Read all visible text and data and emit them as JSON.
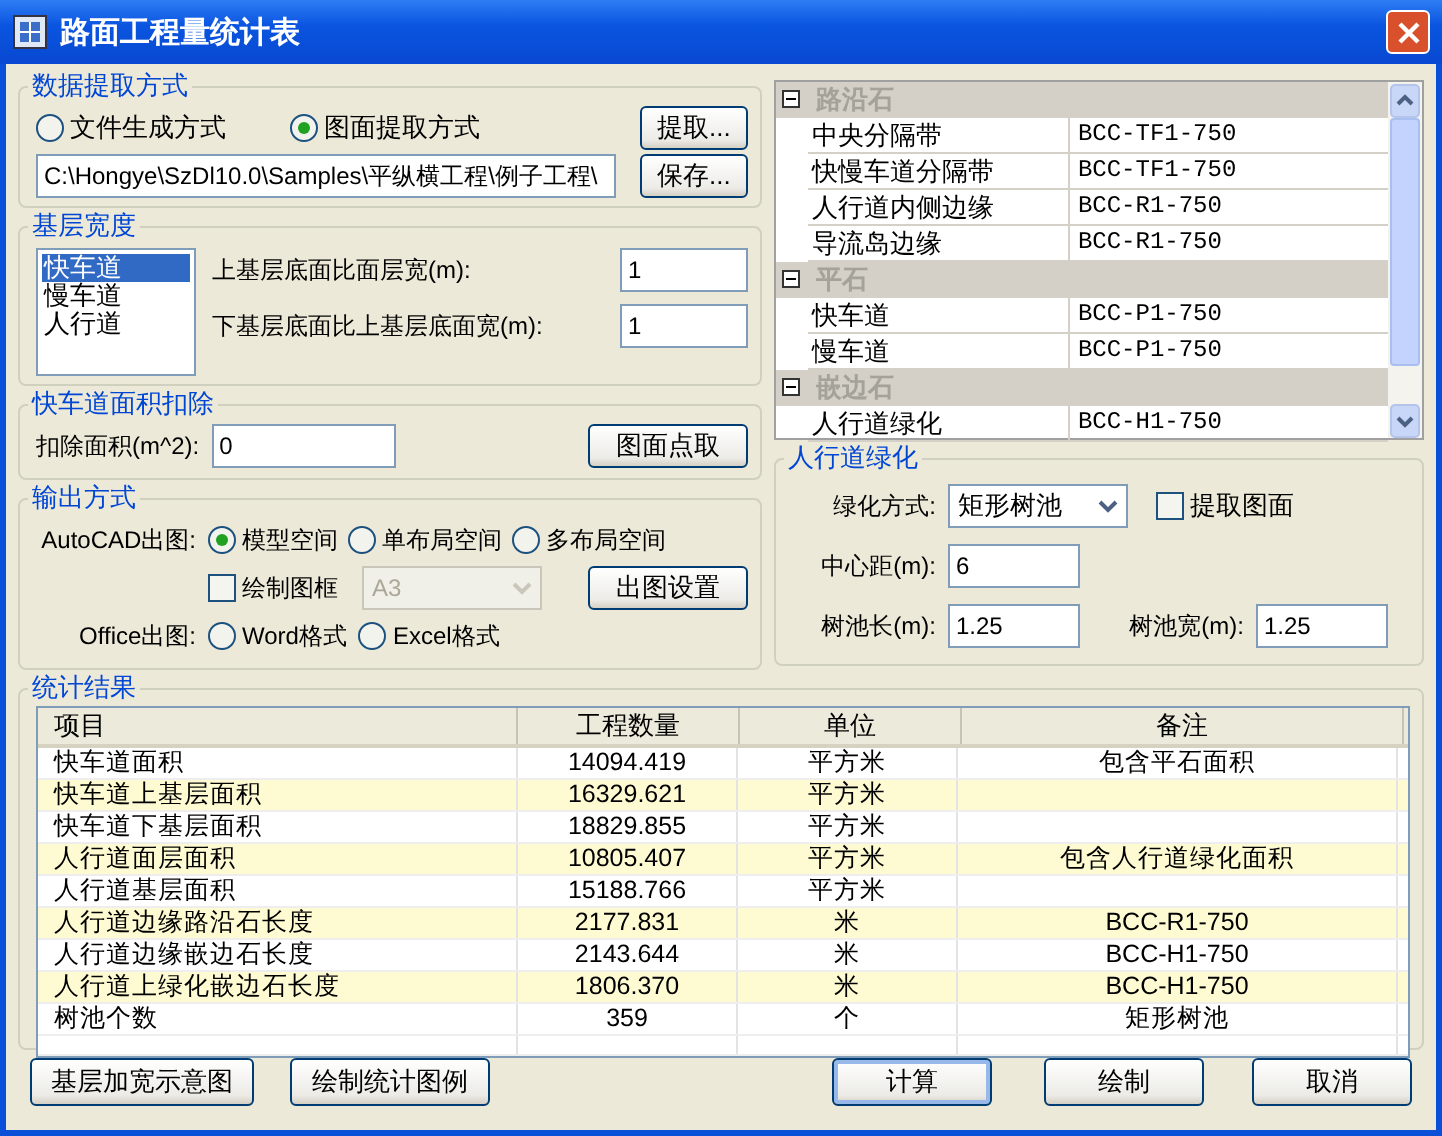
{
  "window": {
    "title": "路面工程量统计表"
  },
  "extraction": {
    "title": "数据提取方式",
    "options": [
      {
        "label": "文件生成方式",
        "selected": false
      },
      {
        "label": "图面提取方式",
        "selected": true
      }
    ],
    "path": "C:\\Hongye\\SzDl10.0\\Samples\\平纵横工程\\例子工程\\",
    "buttons": [
      "提取...",
      "保存..."
    ]
  },
  "base_width": {
    "title": "基层宽度",
    "list": [
      {
        "label": "快车道",
        "selected": true
      },
      {
        "label": "慢车道",
        "selected": false
      },
      {
        "label": "人行道",
        "selected": false
      }
    ],
    "fields": [
      {
        "label": "上基层底面比面层宽(m):",
        "value": "1"
      },
      {
        "label": "下基层底面比上基层底面宽(m):",
        "value": "1"
      }
    ]
  },
  "deduction": {
    "title": "快车道面积扣除",
    "label": "扣除面积(m^2):",
    "value": "0",
    "button": "图面点取"
  },
  "output": {
    "title": "输出方式",
    "autocad_label": "AutoCAD出图:",
    "autocad_options": [
      {
        "label": "模型空间",
        "selected": true
      },
      {
        "label": "单布局空间",
        "selected": false
      },
      {
        "label": "多布局空间",
        "selected": false
      }
    ],
    "frame_checkbox": {
      "label": "绘制图框",
      "checked": false
    },
    "frame_size": {
      "value": "A3",
      "disabled": true
    },
    "settings_button": "出图设置",
    "office_label": "Office出图:",
    "office_options": [
      {
        "label": "Word格式",
        "selected": false
      },
      {
        "label": "Excel格式",
        "selected": false
      }
    ]
  },
  "property_grid": {
    "groups": [
      {
        "name": "路沿石",
        "expanded": true,
        "rows": [
          {
            "name": "中央分隔带",
            "value": "BCC-TF1-750"
          },
          {
            "name": "快慢车道分隔带",
            "value": "BCC-TF1-750"
          },
          {
            "name": "人行道内侧边缘",
            "value": "BCC-R1-750"
          },
          {
            "name": "导流岛边缘",
            "value": "BCC-R1-750"
          }
        ]
      },
      {
        "name": "平石",
        "expanded": true,
        "rows": [
          {
            "name": "快车道",
            "value": "BCC-P1-750"
          },
          {
            "name": "慢车道",
            "value": "BCC-P1-750"
          }
        ]
      },
      {
        "name": "嵌边石",
        "expanded": true,
        "rows": [
          {
            "name": "人行道绿化",
            "value": "BCC-H1-750"
          }
        ]
      }
    ]
  },
  "greening": {
    "title": "人行道绿化",
    "method_label": "绿化方式:",
    "method_value": "矩形树池",
    "extract_checkbox": {
      "label": "提取图面",
      "checked": false
    },
    "center_label": "中心距(m):",
    "center_value": "6",
    "length_label": "树池长(m):",
    "length_value": "1.25",
    "width_label": "树池宽(m):",
    "width_value": "1.25"
  },
  "results": {
    "title": "统计结果",
    "columns": [
      "项目",
      "工程数量",
      "单位",
      "备注"
    ],
    "rows": [
      {
        "cells": [
          "快车道面积",
          "14094.419",
          "平方米",
          "包含平石面积"
        ]
      },
      {
        "cells": [
          "快车道上基层面积",
          "16329.621",
          "平方米",
          ""
        ]
      },
      {
        "cells": [
          "快车道下基层面积",
          "18829.855",
          "平方米",
          ""
        ]
      },
      {
        "cells": [
          "人行道面层面积",
          "10805.407",
          "平方米",
          "包含人行道绿化面积"
        ]
      },
      {
        "cells": [
          "人行道基层面积",
          "15188.766",
          "平方米",
          ""
        ]
      },
      {
        "cells": [
          "人行道边缘路沿石长度",
          "2177.831",
          "米",
          "BCC-R1-750"
        ]
      },
      {
        "cells": [
          "人行道边缘嵌边石长度",
          "2143.644",
          "米",
          "BCC-H1-750"
        ]
      },
      {
        "cells": [
          "人行道上绿化嵌边石长度",
          "1806.370",
          "米",
          "BCC-H1-750"
        ]
      },
      {
        "cells": [
          "树池个数",
          "359",
          "个",
          "矩形树池"
        ]
      }
    ]
  },
  "buttons": [
    {
      "label": "基层加宽示意图",
      "focused": false
    },
    {
      "label": "绘制统计图例",
      "focused": false
    },
    {
      "label": "计算",
      "focused": true
    },
    {
      "label": "绘制",
      "focused": false
    },
    {
      "label": "取消",
      "focused": false
    }
  ]
}
